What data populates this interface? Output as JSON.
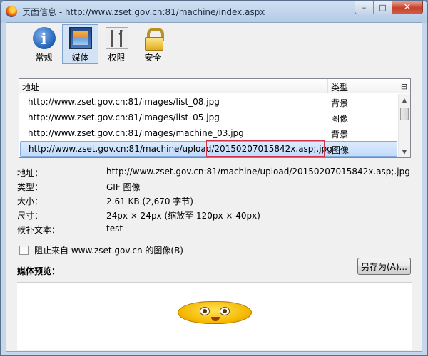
{
  "window": {
    "title": "页面信息 - http://www.zset.gov.cn:81/machine/index.aspx",
    "minimize": "–",
    "maximize": "□",
    "close": "✕"
  },
  "toolbar": [
    {
      "label": "常规",
      "icon": "info-icon"
    },
    {
      "label": "媒体",
      "icon": "media-icon",
      "active": true
    },
    {
      "label": "权限",
      "icon": "permissions-icon"
    },
    {
      "label": "安全",
      "icon": "lock-icon"
    }
  ],
  "media_list": {
    "columns": {
      "address": "地址",
      "type": "类型"
    },
    "rows": [
      {
        "address": "http://www.zset.gov.cn:81/images/list_08.jpg",
        "type": "背景"
      },
      {
        "address": "http://www.zset.gov.cn:81/images/list_05.jpg",
        "type": "图像"
      },
      {
        "address": "http://www.zset.gov.cn:81/images/machine_03.jpg",
        "type": "背景"
      },
      {
        "address": "http://www.zset.gov.cn:81/machine/upload/20150207015842x.asp;.jpg",
        "type": "图像",
        "selected": true
      }
    ]
  },
  "details": {
    "address_label": "地址：",
    "address_value": "http://www.zset.gov.cn:81/machine/upload/20150207015842x.asp;.jpg",
    "type_label": "类型：",
    "type_value": "GIF 图像",
    "size_label": "大小：",
    "size_value": "2.61 KB (2,670 字节)",
    "dimensions_label": "尺寸：",
    "dimensions_value": "24px × 24px (缩放至 120px × 40px)",
    "alt_label": "候补文本：",
    "alt_value": "test"
  },
  "block_images": {
    "label": "阻止来自 www.zset.gov.cn 的图像(B)",
    "checked": false
  },
  "save_as_button": "另存为(A)...",
  "preview_label": "媒体预览："
}
